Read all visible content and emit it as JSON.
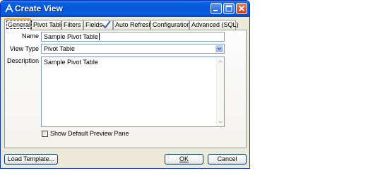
{
  "window": {
    "title": "Create View",
    "icon": "app-logo-icon"
  },
  "title_buttons": [
    "minimize-icon",
    "maximize-icon",
    "close-icon"
  ],
  "tabs": [
    {
      "label": "General",
      "active": true
    },
    {
      "label": "Pivot Table"
    },
    {
      "label": "Filters"
    },
    {
      "label": "Fields",
      "icon": "checkmark-icon"
    },
    {
      "label": "Auto Refresh"
    },
    {
      "label": "Configuration"
    },
    {
      "label": "Advanced (SQL)"
    }
  ],
  "form": {
    "name_label": "Name",
    "name_value": "Sample Pivot Table",
    "view_type_label": "View Type",
    "view_type_value": "Pivot Table",
    "description_label": "Description",
    "description_value": "Sample Pivot Table",
    "show_preview_label": "Show Default Preview Pane",
    "show_preview_checked": false
  },
  "buttons": {
    "load_template": "Load Template...",
    "ok": "OK",
    "cancel": "Cancel"
  },
  "colors": {
    "titlebar": "#0556d8",
    "active_tab_accent": "#f5a72e",
    "checkmark": "#3b5fb5"
  }
}
